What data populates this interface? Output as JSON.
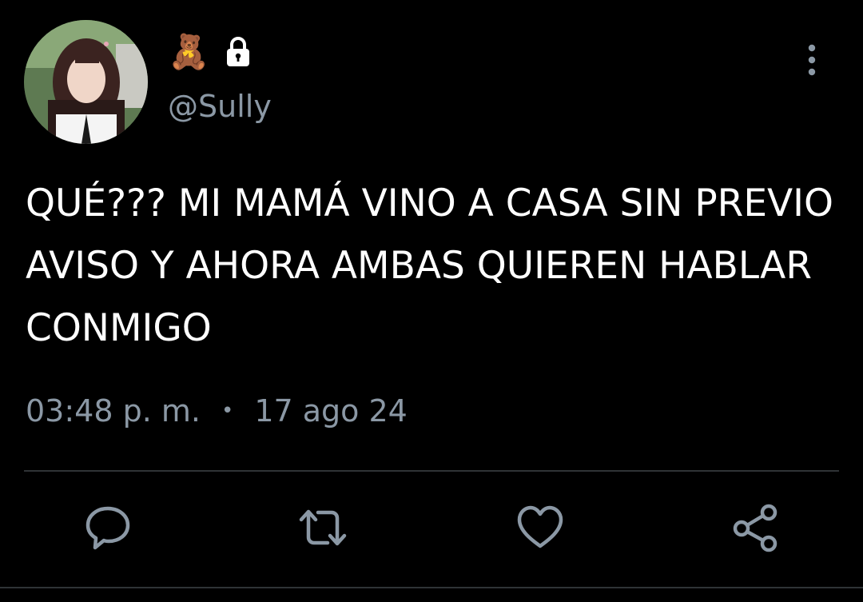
{
  "user": {
    "display_name": "🧸",
    "handle": "@Sully",
    "protected": true,
    "avatar_icon": "profile-photo"
  },
  "tweet": {
    "text": "QUÉ??? MI MAMÁ VINO A CASA SIN PREVIO AVISO Y AHORA AMBAS QUIEREN HABLAR CONMIGO",
    "time": "03:48 p. m.",
    "separator": "•",
    "date": "17 ago 24"
  },
  "actions": [
    {
      "name": "reply",
      "icon": "speech-bubble-icon"
    },
    {
      "name": "retweet",
      "icon": "retweet-arrows-icon"
    },
    {
      "name": "like",
      "icon": "heart-icon"
    },
    {
      "name": "share",
      "icon": "share-icon"
    }
  ],
  "colors": {
    "background": "#000000",
    "text": "#ffffff",
    "secondary": "#8b98a5",
    "divider": "#2f3336"
  }
}
